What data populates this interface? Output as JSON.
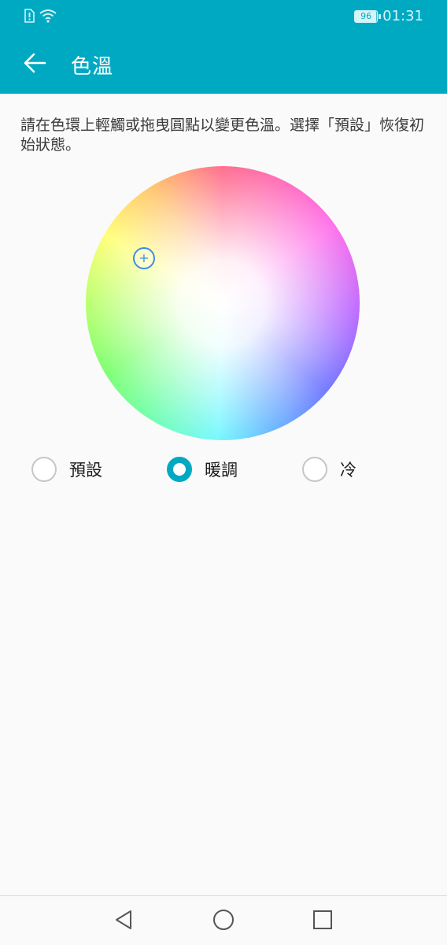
{
  "status_bar": {
    "battery": "96",
    "battery_level": 0.96,
    "time": "01:31",
    "icons": [
      "sim-alert-icon",
      "wifi-icon",
      "battery-icon"
    ]
  },
  "header": {
    "title": "色溫",
    "back_icon": "arrow-left-icon"
  },
  "instruction": "請在色環上輕觸或拖曳圓點以變更色溫。選擇「預設」恢復初始狀態。",
  "options": [
    {
      "label": "預設",
      "checked": false
    },
    {
      "label": "暖調",
      "checked": true
    },
    {
      "label": "冷",
      "checked": false
    }
  ],
  "navbar": {
    "icons": [
      "back-triangle-icon",
      "home-circle-icon",
      "recents-square-icon"
    ]
  },
  "colors": {
    "accent": "#00a9c2",
    "handle": "#3d8fe0"
  }
}
